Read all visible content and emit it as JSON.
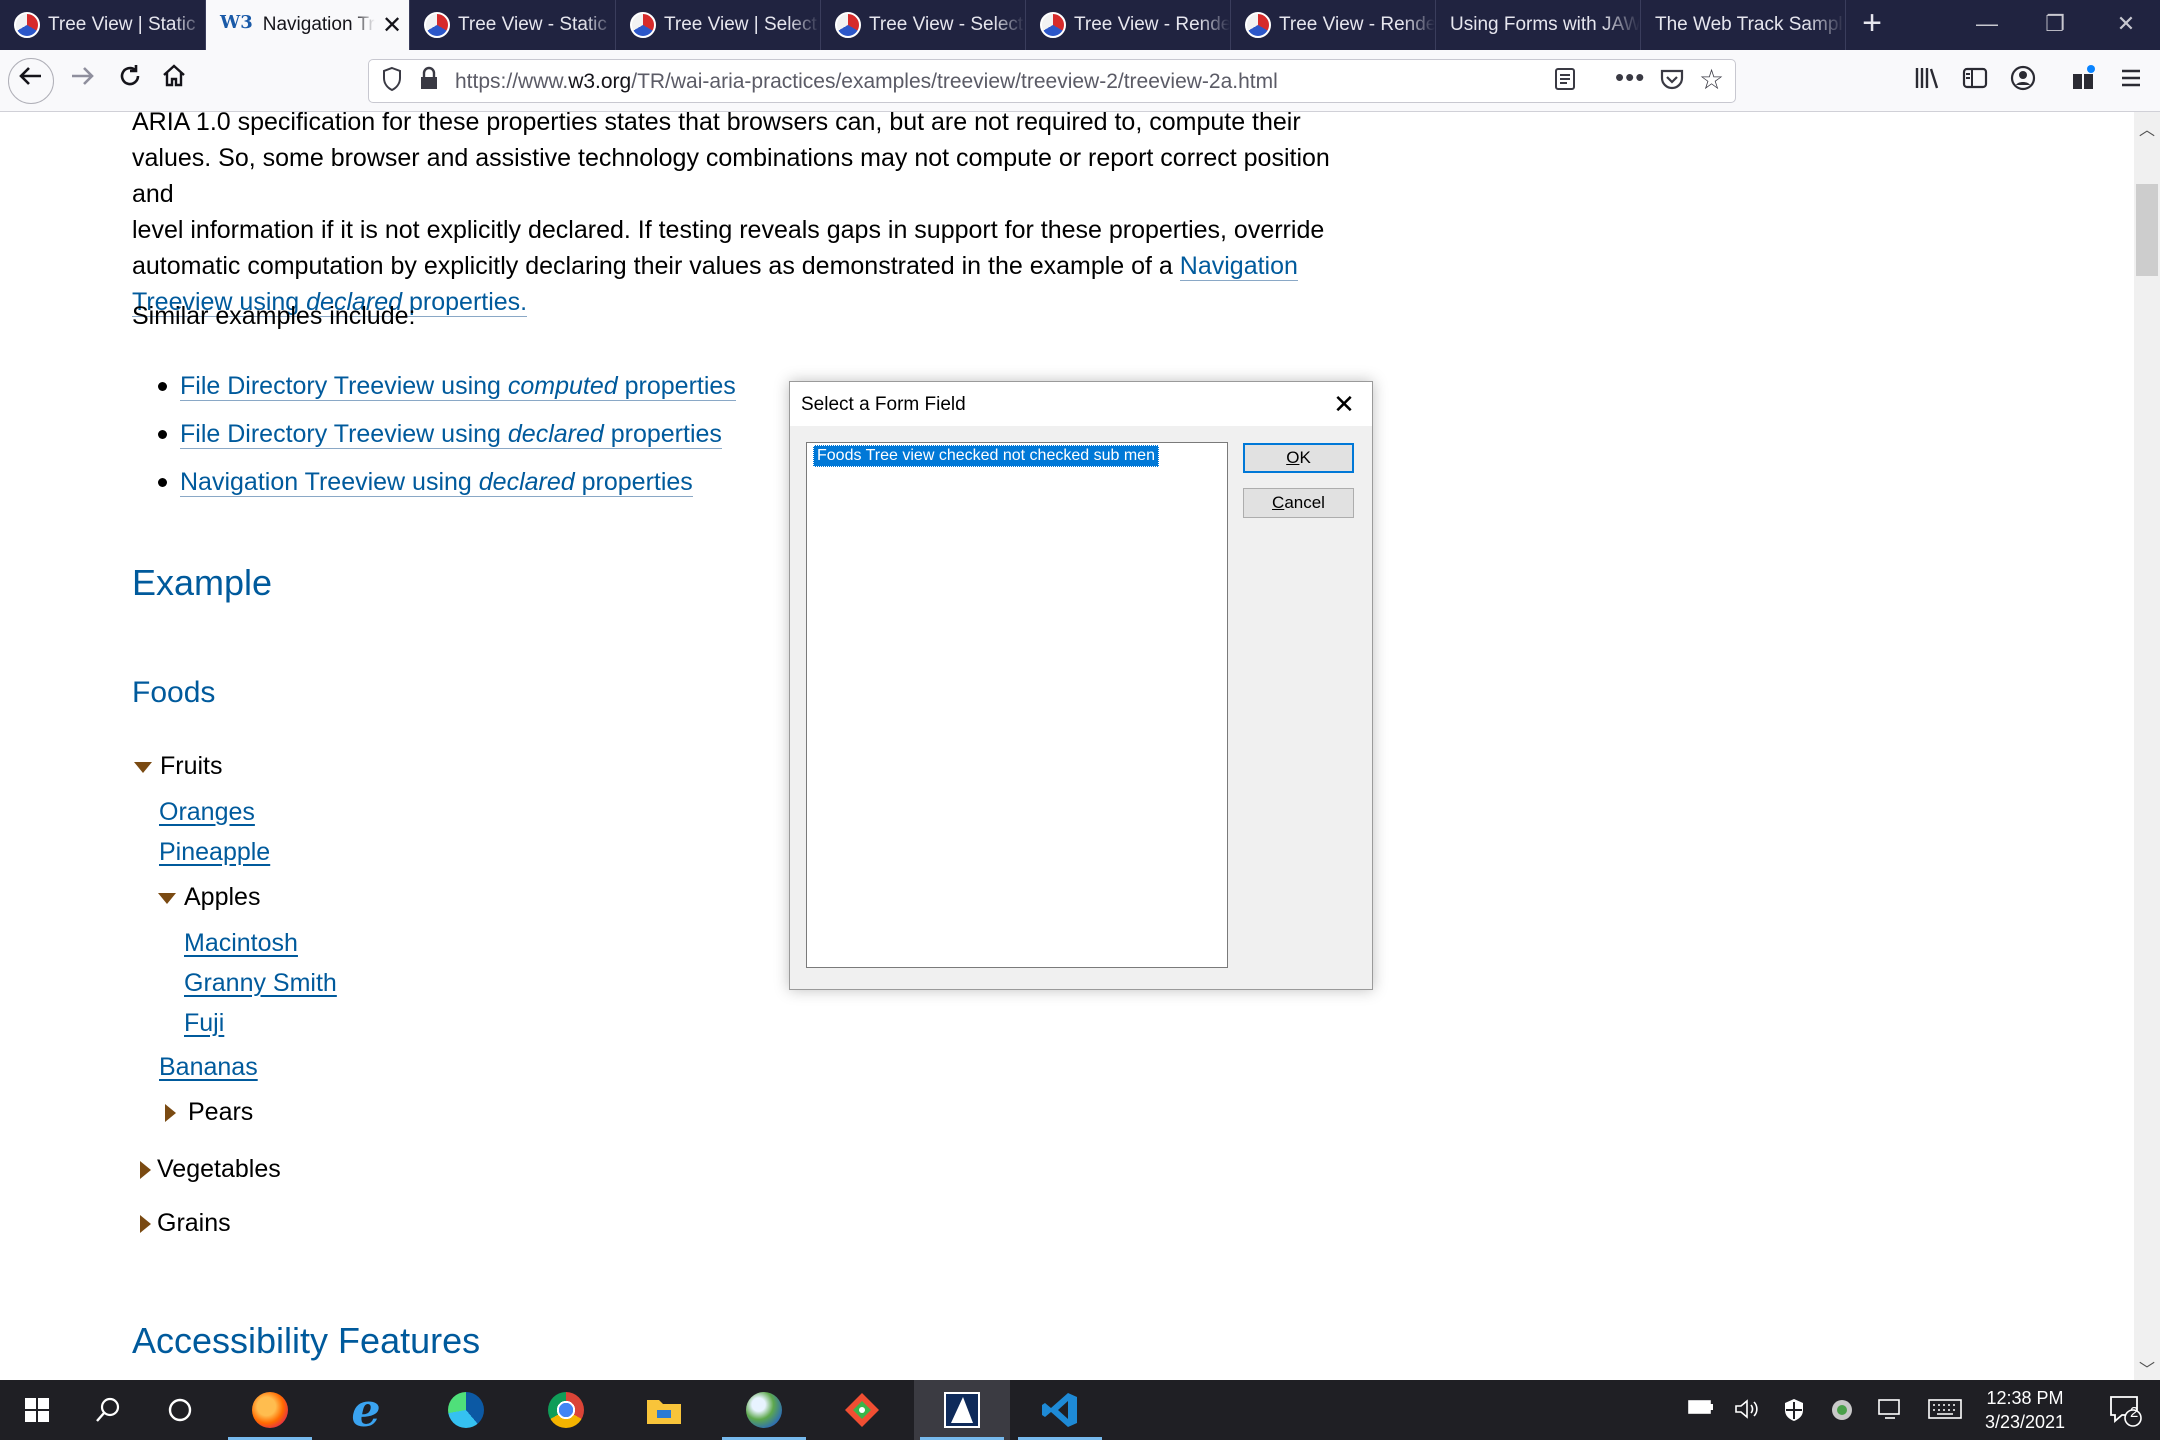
{
  "tabs": [
    {
      "label": "Tree View | Static",
      "active": false
    },
    {
      "label": "Navigation Tre",
      "active": true
    },
    {
      "label": "Tree View - Static",
      "active": false
    },
    {
      "label": "Tree View | Select",
      "active": false
    },
    {
      "label": "Tree View - Select",
      "active": false
    },
    {
      "label": "Tree View - Rende",
      "active": false
    },
    {
      "label": "Tree View - Rende",
      "active": false
    },
    {
      "label": "Using Forms with JAW",
      "active": false
    },
    {
      "label": "The Web Track Sampl",
      "active": false
    }
  ],
  "url": {
    "prefix": "https://www.",
    "domain": "w3.org",
    "path": "/TR/wai-aria-practices/examples/treeview/treeview-2/treeview-2a.html"
  },
  "content": {
    "para_line1": "ARIA 1.0 specification for these properties states that browsers can, but are not required to, compute their",
    "para_line2": "values. So, some browser and assistive technology combinations may not compute or report correct position and",
    "para_line3": "level information if it is not explicitly declared. If testing reveals gaps in support for these properties, override",
    "para_line4": "automatic computation by explicitly declaring their values as demonstrated in the example of a ",
    "para_link_a": "Navigation",
    "para_link_b": "Treeview using ",
    "para_link_em": "declared",
    "para_link_c": " properties.",
    "similar_heading": "Similar examples include:",
    "similar": [
      {
        "a": "File Directory Treeview using ",
        "em": "computed",
        "b": " properties"
      },
      {
        "a": "File Directory Treeview using ",
        "em": "declared",
        "b": " properties"
      },
      {
        "a": "Navigation Treeview using ",
        "em": "declared",
        "b": " properties"
      }
    ],
    "example_heading": "Example",
    "foods_heading": "Foods",
    "tree": {
      "fruits": "Fruits",
      "oranges": "Oranges",
      "pineapple": "Pineapple",
      "apples": "Apples",
      "macintosh": "Macintosh",
      "granny_smith": "Granny Smith",
      "fuji": "Fuji",
      "bananas": "Bananas",
      "pears": "Pears",
      "vegetables": "Vegetables",
      "grains": "Grains"
    },
    "access_heading": "Accessibility Features"
  },
  "dialog": {
    "title": "Select a Form Field",
    "selected_item": "Foods Tree view  checked  not checked  sub men",
    "ok_label_u": "O",
    "ok_label_rest": "K",
    "cancel_label_u": "C",
    "cancel_label_rest": "ancel"
  },
  "taskbar": {
    "time": "12:38 PM",
    "date": "3/23/2021",
    "notification_count": "2"
  }
}
